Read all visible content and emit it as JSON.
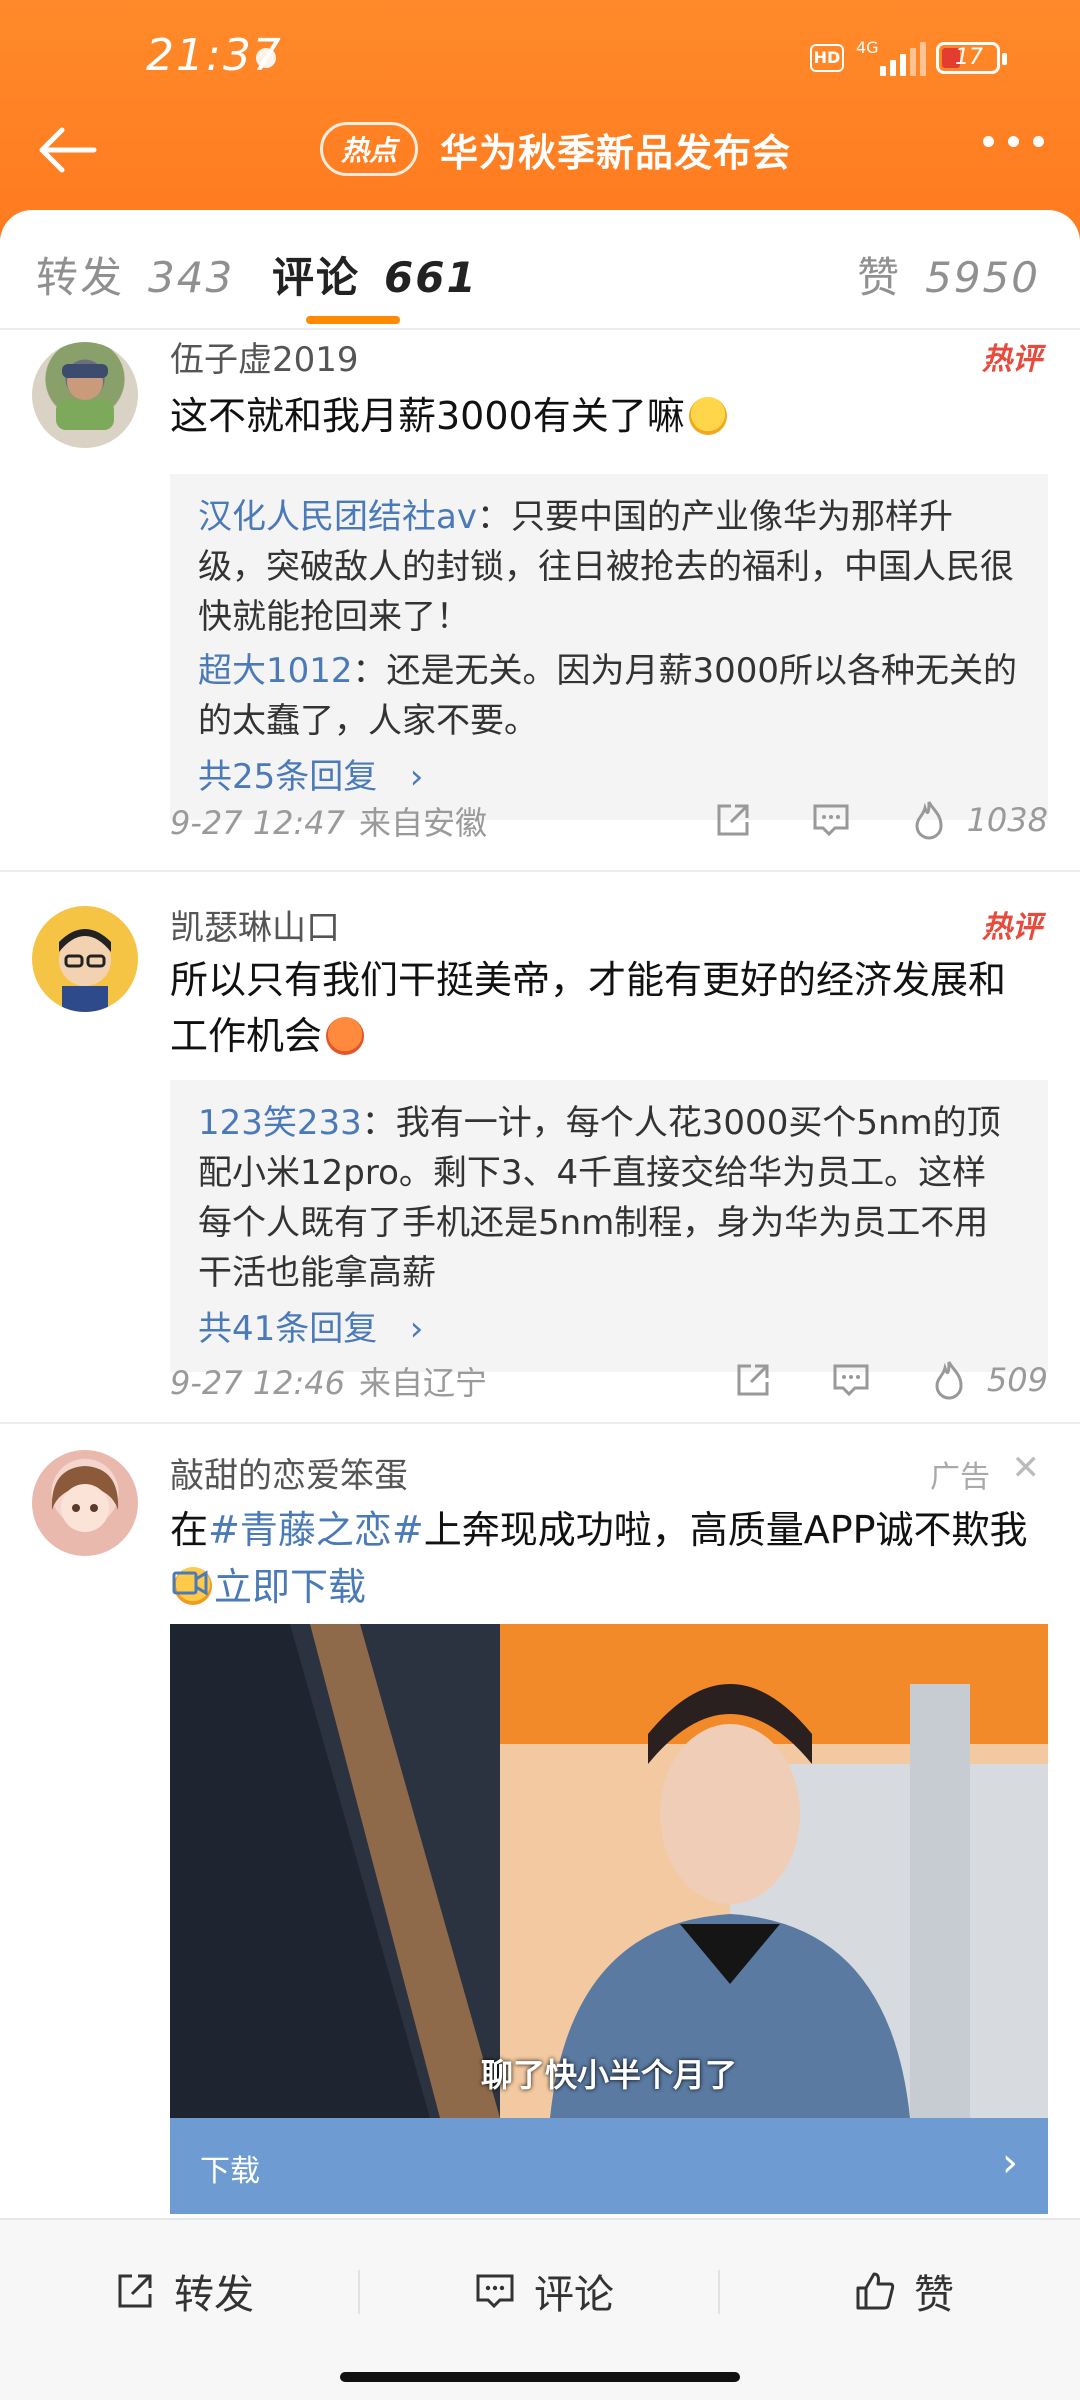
{
  "status": {
    "time": "21:37",
    "network": "4G",
    "battery": "17"
  },
  "header": {
    "hot_tag": "热点",
    "title": "华为秋季新品发布会"
  },
  "tabs": [
    {
      "label": "转发",
      "count": "343"
    },
    {
      "label": "评论",
      "count": "661"
    },
    {
      "label": "赞",
      "count": "5950"
    }
  ],
  "comments": [
    {
      "user": "伍子虚2019",
      "badge": "热评",
      "text": "这不就和我月薪3000有关了嘛",
      "replies": [
        {
          "user": "汉化人民团结社av",
          "text": "：只要中国的产业像华为那样升级，突破敌人的封锁，往日被抢去的福利，中国人民很快就能抢回来了！"
        },
        {
          "user": "超大1012",
          "text": "：还是无关。因为月薪3000所以各种无关的的太蠢了，人家不要。"
        }
      ],
      "more": "共25条回复",
      "date": "9-27 12:47",
      "location": "来自安徽",
      "likes": "1038"
    },
    {
      "user": "凯瑟琳山口",
      "badge": "热评",
      "text": "所以只有我们干挺美帝，才能有更好的经济发展和工作机会",
      "replies": [
        {
          "user": "123笑233",
          "text": "：我有一计，每个人花3000买个5nm的顶配小米12pro。剩下3、4千直接交给华为员工。这样每个人既有了手机还是5nm制程，身为华为员工不用干活也能拿高薪"
        }
      ],
      "more": "共41条回复",
      "date": "9-27 12:46",
      "location": "来自辽宁",
      "likes": "509"
    }
  ],
  "ad": {
    "user": "敲甜的恋爱笨蛋",
    "label": "广告",
    "text_prefix": "在",
    "tag": "#青藤之恋#",
    "text_suffix": "上奔现成功啦，高质量APP诚不欺我",
    "download_link": "立即下载",
    "caption": "聊了快小半个月了",
    "bar_label": "下载"
  },
  "bottom": {
    "forward": "转发",
    "comment": "评论",
    "like": "赞"
  },
  "colors": {
    "header": "#ff7a1e",
    "accent": "#ff8a00",
    "link": "#4b7ab8",
    "hot": "#e84a3c"
  }
}
